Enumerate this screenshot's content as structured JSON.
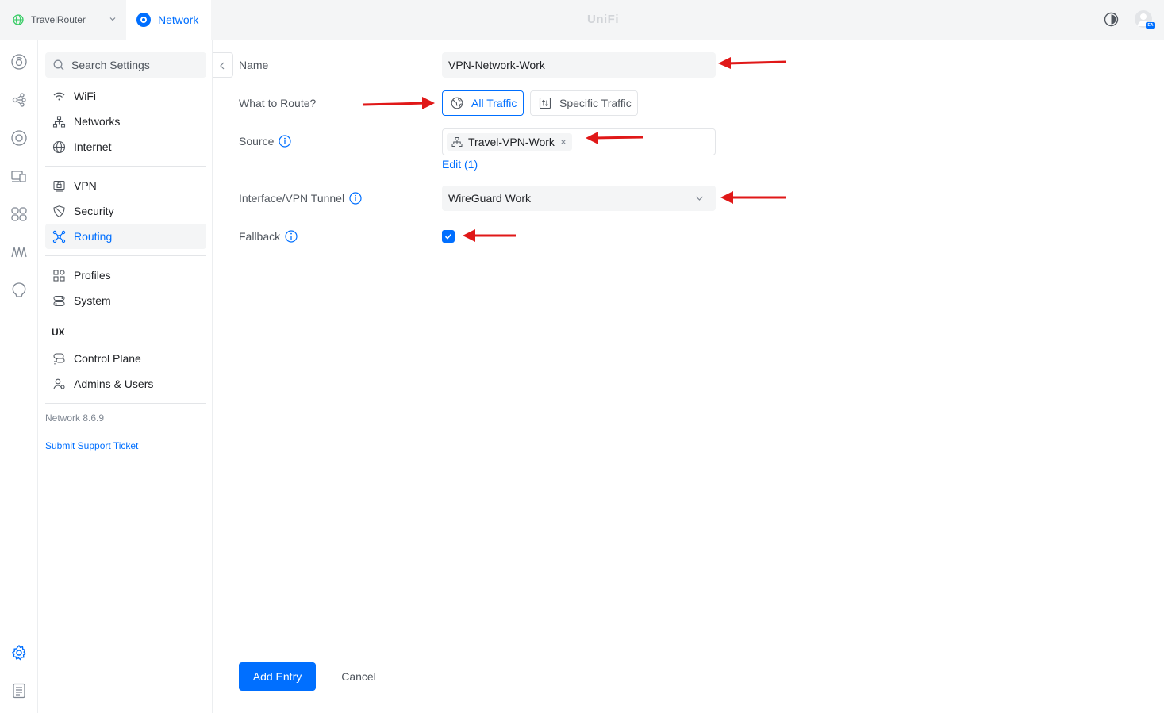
{
  "topbar": {
    "site_name": "TravelRouter",
    "app_name": "Network",
    "brand": "UniFi",
    "avatar_badge": "EA"
  },
  "rail": {
    "icons": [
      "dashboard-icon",
      "topology-icon",
      "devices-icon",
      "client-devices-icon",
      "ports-icon",
      "insights-icon",
      "alerts-icon",
      "settings-icon",
      "logs-icon"
    ],
    "active": "settings-icon"
  },
  "sidebar": {
    "search_placeholder": "Search Settings",
    "groups": [
      [
        {
          "label": "WiFi",
          "icon": "wifi-icon"
        },
        {
          "label": "Networks",
          "icon": "networks-icon"
        },
        {
          "label": "Internet",
          "icon": "internet-globe-icon"
        }
      ],
      [
        {
          "label": "VPN",
          "icon": "vpn-icon"
        },
        {
          "label": "Security",
          "icon": "shield-icon"
        },
        {
          "label": "Routing",
          "icon": "routing-icon"
        }
      ],
      [
        {
          "label": "Profiles",
          "icon": "profiles-icon"
        },
        {
          "label": "System",
          "icon": "system-icon"
        }
      ]
    ],
    "active_item": "Routing",
    "ux_section_title": "UX",
    "ux_items": [
      {
        "label": "Control Plane",
        "icon": "control-plane-icon"
      },
      {
        "label": "Admins & Users",
        "icon": "admins-users-icon"
      }
    ],
    "version": "Network 8.6.9",
    "support_link": "Submit Support Ticket"
  },
  "form": {
    "name_label": "Name",
    "name_value": "VPN-Network-Work",
    "route_label": "What to Route?",
    "route_options": [
      "All Traffic",
      "Specific Traffic"
    ],
    "route_selected": "All Traffic",
    "source_label": "Source",
    "source_chip": "Travel-VPN-Work",
    "source_edit": "Edit (1)",
    "interface_label": "Interface/VPN Tunnel",
    "interface_value": "WireGuard Work",
    "fallback_label": "Fallback",
    "fallback_checked": true
  },
  "actions": {
    "primary": "Add Entry",
    "cancel": "Cancel"
  },
  "colors": {
    "accent": "#006fff",
    "annotation_arrow": "#e01818"
  }
}
